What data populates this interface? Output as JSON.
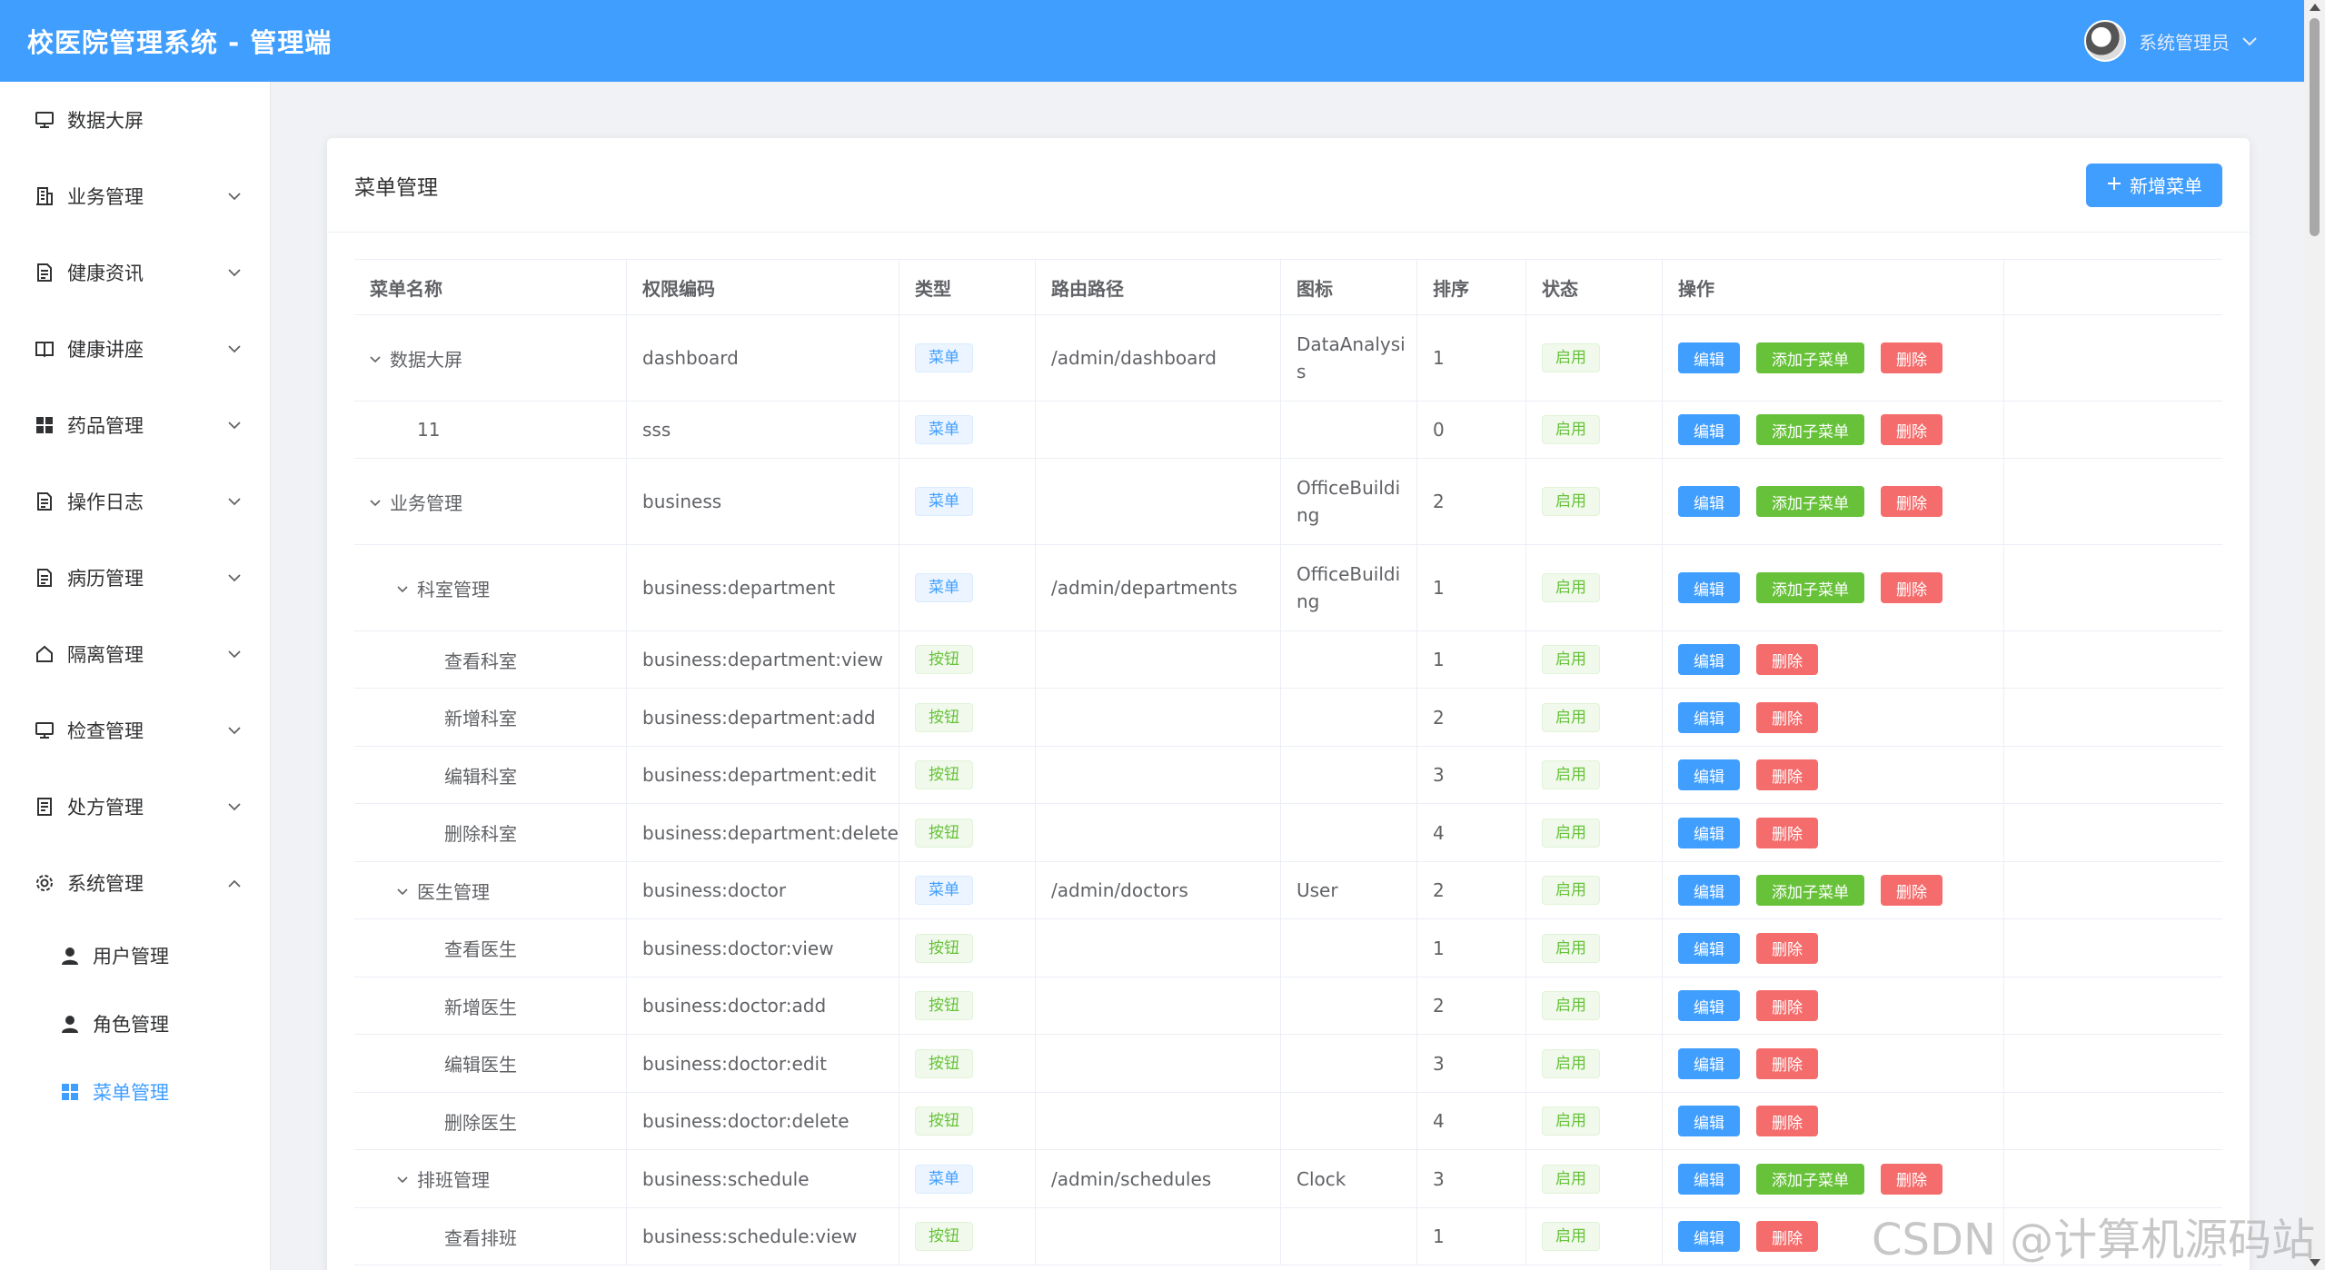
{
  "header": {
    "title": "校医院管理系统 - 管理端",
    "user_name": "系统管理员"
  },
  "sidebar": {
    "items": [
      {
        "label": "数据大屏",
        "icon": "monitor-icon",
        "arrow": ""
      },
      {
        "label": "业务管理",
        "icon": "office-building-icon",
        "arrow": "down"
      },
      {
        "label": "健康资讯",
        "icon": "document-icon",
        "arrow": "down"
      },
      {
        "label": "健康讲座",
        "icon": "reading-icon",
        "arrow": "down"
      },
      {
        "label": "药品管理",
        "icon": "grid-icon",
        "arrow": "down"
      },
      {
        "label": "操作日志",
        "icon": "document-icon",
        "arrow": "down"
      },
      {
        "label": "病历管理",
        "icon": "document-icon",
        "arrow": "down"
      },
      {
        "label": "隔离管理",
        "icon": "house-icon",
        "arrow": "down"
      },
      {
        "label": "检查管理",
        "icon": "monitor-icon",
        "arrow": "down"
      },
      {
        "label": "处方管理",
        "icon": "tickets-icon",
        "arrow": "down"
      },
      {
        "label": "系统管理",
        "icon": "gear-icon",
        "arrow": "up"
      }
    ],
    "sub_items": [
      {
        "label": "用户管理",
        "icon": "user-icon",
        "active": false
      },
      {
        "label": "角色管理",
        "icon": "user-icon",
        "active": false
      },
      {
        "label": "菜单管理",
        "icon": "grid-icon",
        "active": true
      }
    ]
  },
  "card": {
    "title": "菜单管理",
    "add_button": "新增菜单"
  },
  "table": {
    "headers": [
      "菜单名称",
      "权限编码",
      "类型",
      "路由路径",
      "图标",
      "排序",
      "状态",
      "操作"
    ],
    "labels": {
      "edit": "编辑",
      "add_child": "添加子菜单",
      "delete": "删除"
    },
    "rows": [
      {
        "name": "数据大屏",
        "level": 0,
        "expand": true,
        "code": "dashboard",
        "type": "菜单",
        "type_kind": "menu",
        "path": "/admin/dashboard",
        "icon_lines": [
          "DataAnalysi",
          "s"
        ],
        "sort": "1",
        "status": "启用",
        "add_child": true,
        "height": 95
      },
      {
        "name": "11",
        "level": 1,
        "expand": false,
        "code": "sss",
        "type": "菜单",
        "type_kind": "menu",
        "path": "",
        "icon_lines": [],
        "sort": "0",
        "status": "启用",
        "add_child": true,
        "height": 63
      },
      {
        "name": "业务管理",
        "level": 0,
        "expand": true,
        "code": "business",
        "type": "菜单",
        "type_kind": "menu",
        "path": "",
        "icon_lines": [
          "OfficeBuildi",
          "ng"
        ],
        "sort": "2",
        "status": "启用",
        "add_child": true,
        "height": 95
      },
      {
        "name": "科室管理",
        "level": 1,
        "expand": true,
        "code": "business:department",
        "type": "菜单",
        "type_kind": "menu",
        "path": "/admin/departments",
        "icon_lines": [
          "OfficeBuildi",
          "ng"
        ],
        "sort": "1",
        "status": "启用",
        "add_child": true,
        "height": 95
      },
      {
        "name": "查看科室",
        "level": 2,
        "expand": false,
        "code": "business:department:view",
        "type": "按钮",
        "type_kind": "btn",
        "path": "",
        "icon_lines": [],
        "sort": "1",
        "status": "启用",
        "add_child": false,
        "height": 63
      },
      {
        "name": "新增科室",
        "level": 2,
        "expand": false,
        "code": "business:department:add",
        "type": "按钮",
        "type_kind": "btn",
        "path": "",
        "icon_lines": [],
        "sort": "2",
        "status": "启用",
        "add_child": false,
        "height": 64
      },
      {
        "name": "编辑科室",
        "level": 2,
        "expand": false,
        "code": "business:department:edit",
        "type": "按钮",
        "type_kind": "btn",
        "path": "",
        "icon_lines": [],
        "sort": "3",
        "status": "启用",
        "add_child": false,
        "height": 63
      },
      {
        "name": "删除科室",
        "level": 2,
        "expand": false,
        "code": "business:department:delete",
        "type": "按钮",
        "type_kind": "btn",
        "path": "",
        "icon_lines": [],
        "sort": "4",
        "status": "启用",
        "add_child": false,
        "height": 64
      },
      {
        "name": "医生管理",
        "level": 1,
        "expand": true,
        "code": "business:doctor",
        "type": "菜单",
        "type_kind": "menu",
        "path": "/admin/doctors",
        "icon_lines": [
          "User"
        ],
        "sort": "2",
        "status": "启用",
        "add_child": true,
        "height": 63
      },
      {
        "name": "查看医生",
        "level": 2,
        "expand": false,
        "code": "business:doctor:view",
        "type": "按钮",
        "type_kind": "btn",
        "path": "",
        "icon_lines": [],
        "sort": "1",
        "status": "启用",
        "add_child": false,
        "height": 64
      },
      {
        "name": "新增医生",
        "level": 2,
        "expand": false,
        "code": "business:doctor:add",
        "type": "按钮",
        "type_kind": "btn",
        "path": "",
        "icon_lines": [],
        "sort": "2",
        "status": "启用",
        "add_child": false,
        "height": 63
      },
      {
        "name": "编辑医生",
        "level": 2,
        "expand": false,
        "code": "business:doctor:edit",
        "type": "按钮",
        "type_kind": "btn",
        "path": "",
        "icon_lines": [],
        "sort": "3",
        "status": "启用",
        "add_child": false,
        "height": 64
      },
      {
        "name": "删除医生",
        "level": 2,
        "expand": false,
        "code": "business:doctor:delete",
        "type": "按钮",
        "type_kind": "btn",
        "path": "",
        "icon_lines": [],
        "sort": "4",
        "status": "启用",
        "add_child": false,
        "height": 63
      },
      {
        "name": "排班管理",
        "level": 1,
        "expand": true,
        "code": "business:schedule",
        "type": "菜单",
        "type_kind": "menu",
        "path": "/admin/schedules",
        "icon_lines": [
          "Clock"
        ],
        "sort": "3",
        "status": "启用",
        "add_child": true,
        "height": 64
      },
      {
        "name": "查看排班",
        "level": 2,
        "expand": false,
        "code": "business:schedule:view",
        "type": "按钮",
        "type_kind": "btn",
        "path": "",
        "icon_lines": [],
        "sort": "1",
        "status": "启用",
        "add_child": false,
        "height": 63
      }
    ]
  },
  "watermark": "CSDN @计算机源码站"
}
